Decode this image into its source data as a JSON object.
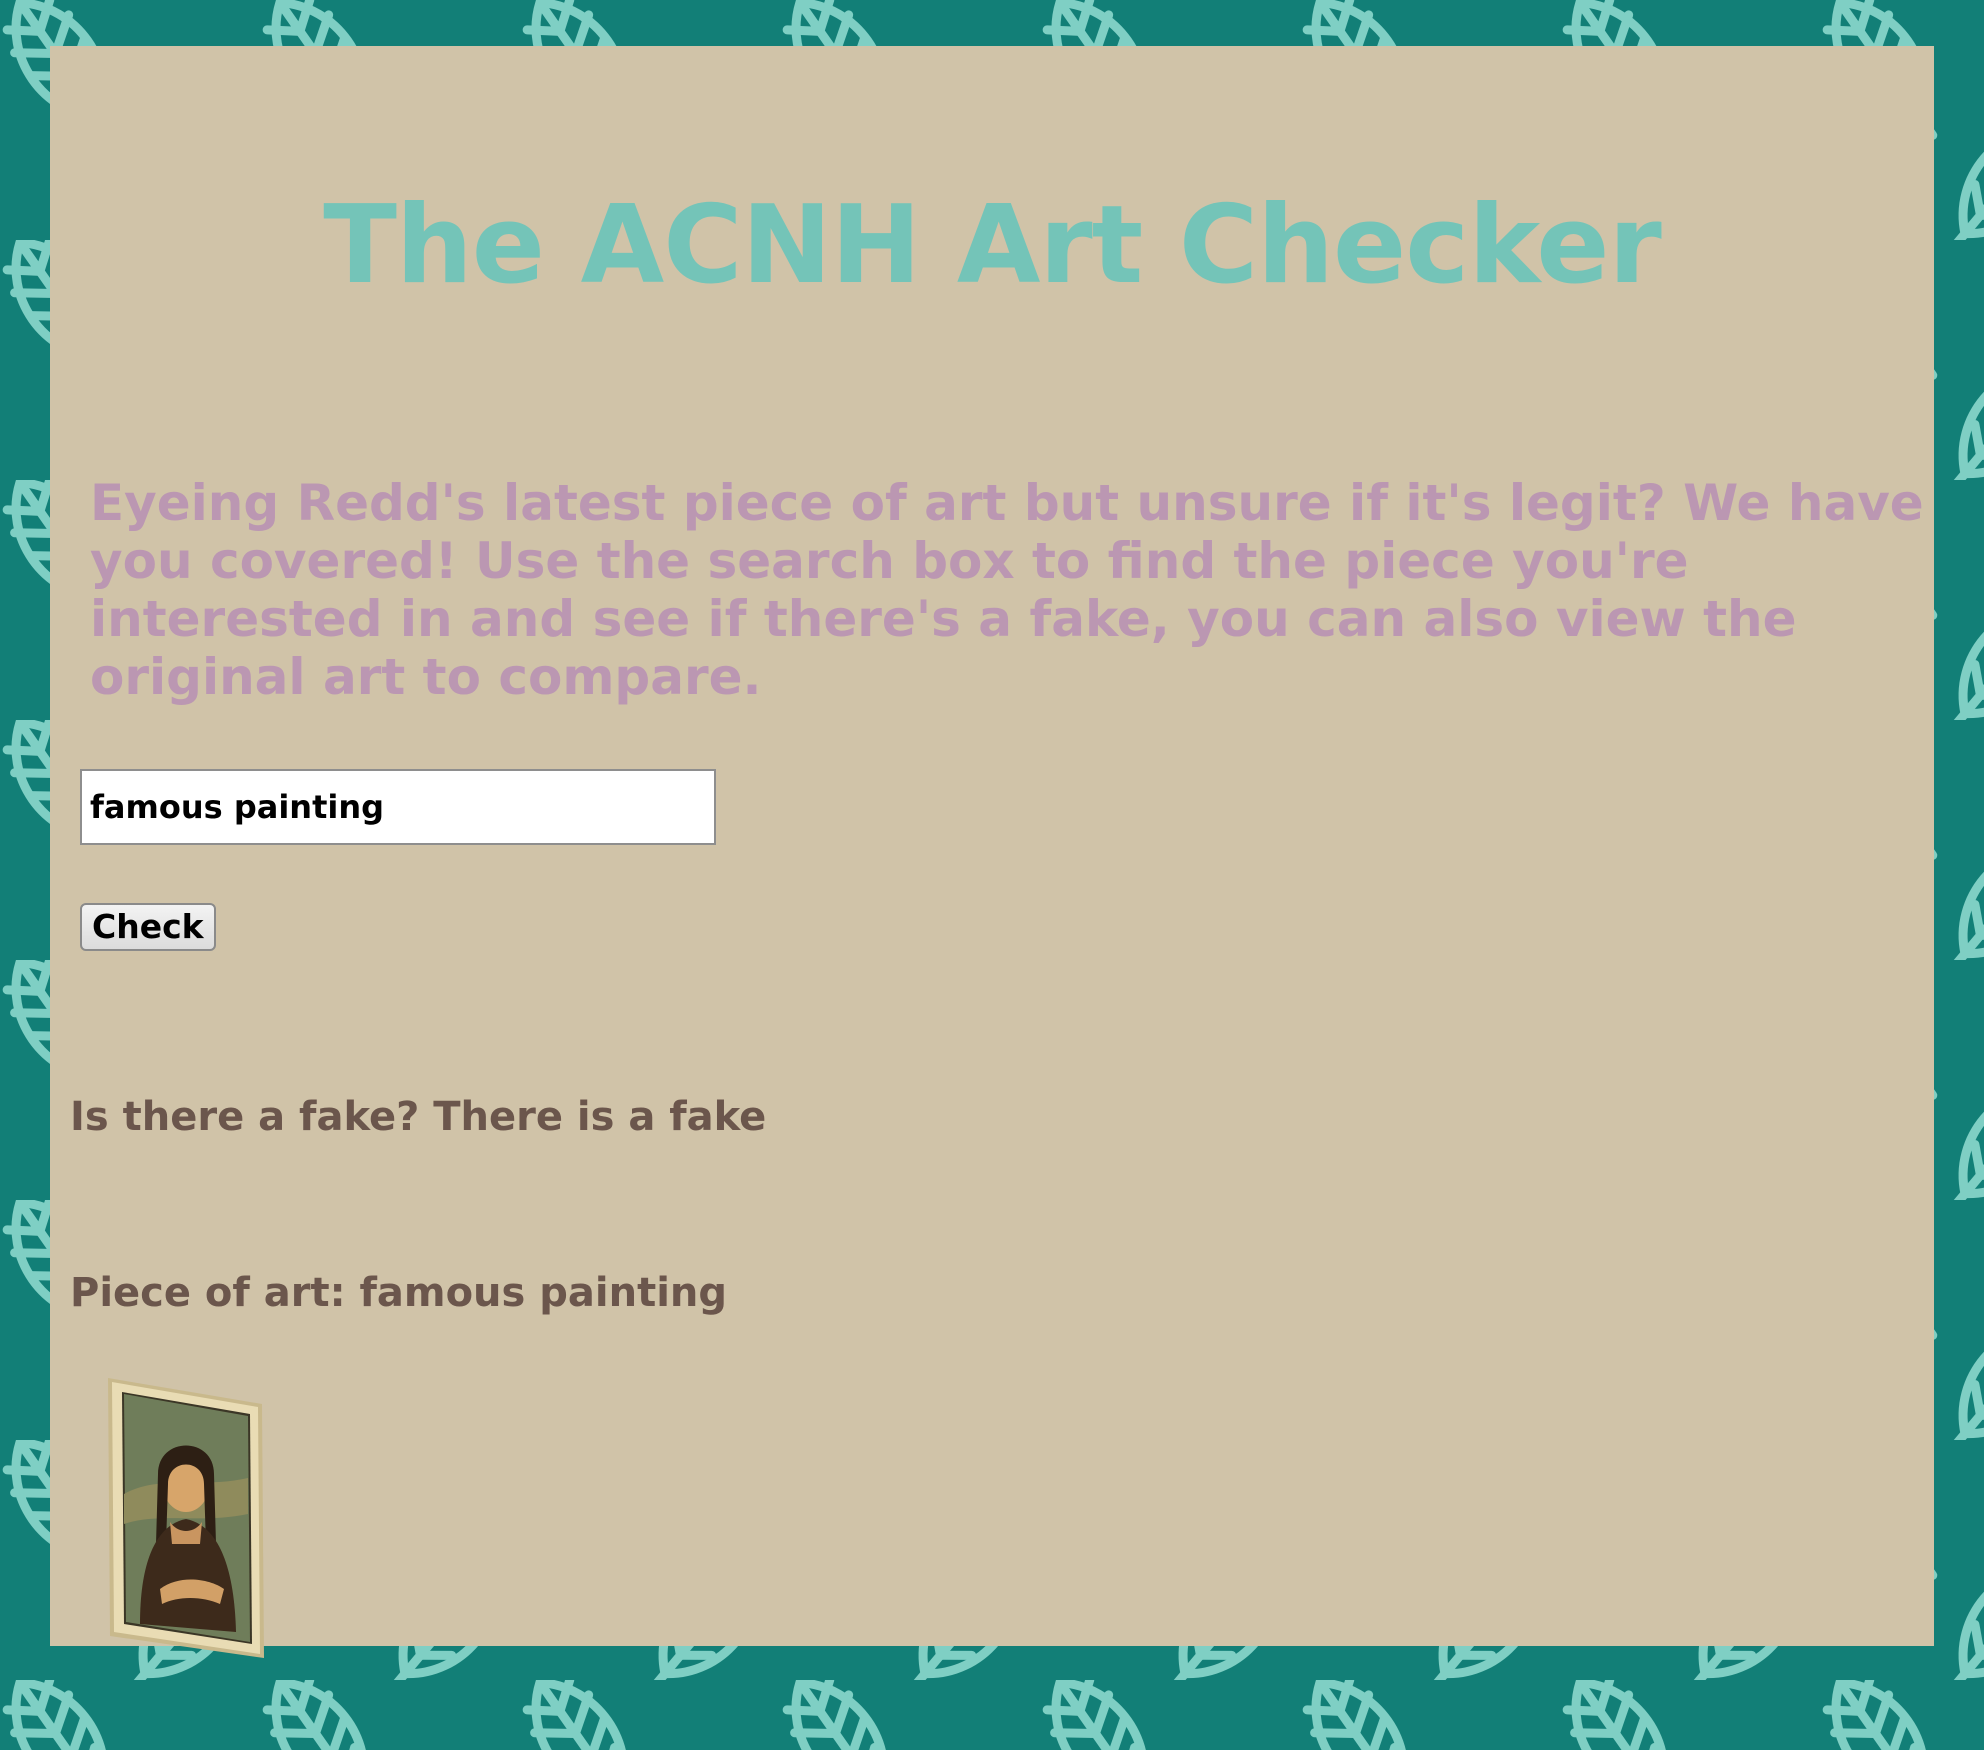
{
  "page": {
    "title": "The ACNH Art Checker",
    "intro": "Eyeing Redd's latest piece of art but unsure if it's legit? We have you covered! Use the search box to find the piece you're interested in and see if there's a fake, you can also view the original art to compare."
  },
  "search": {
    "value": "famous painting",
    "button_label": "Check"
  },
  "result": {
    "fake_text": "Is there a fake? There is a fake",
    "piece_text": "Piece of art: famous painting",
    "image_icon": "framed-mona-lisa-painting"
  },
  "colors": {
    "background": "#127f77",
    "leaf_pattern": "#7fcfc4",
    "panel": "#d0c3a8",
    "title": "#74c4b8",
    "intro": "#bb97b2",
    "result_text": "#6b564c"
  }
}
